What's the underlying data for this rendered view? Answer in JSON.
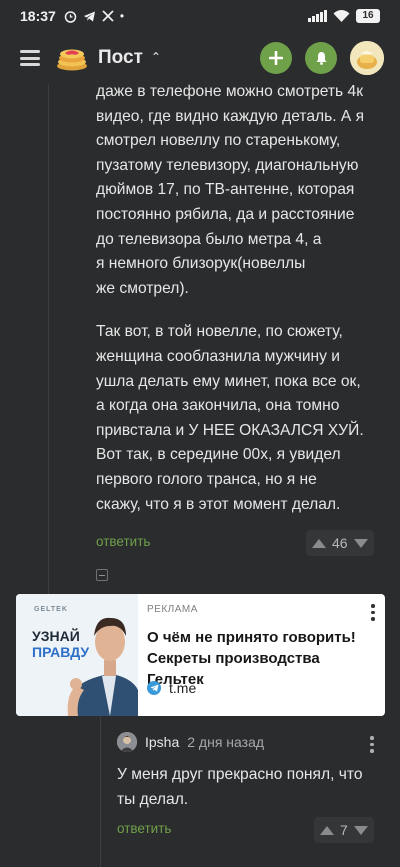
{
  "status_bar": {
    "time": "18:37",
    "battery": "16",
    "icons": [
      "alarm-icon",
      "telegram-icon",
      "x-icon",
      "dots-icon",
      "signal-icon",
      "wifi-icon",
      "battery-icon"
    ]
  },
  "header": {
    "title": "Пост",
    "menu_icon": "hamburger-icon",
    "add_icon": "plus-icon",
    "notify_icon": "bell-icon",
    "accent_color": "#6fa04a"
  },
  "comment": {
    "paragraphs": [
      [
        "даже в телефоне можно смотреть 4к",
        "видео, где видно каждую деталь. А я",
        "смотрел новеллу по старенькому,",
        "пузатому телевизору, диагональную",
        "дюймов 17, по ТВ-антенне, которая",
        "постоянно рябила, да и расстояние",
        "до телевизора было метра 4, а",
        "я немного близорук(новеллы",
        "же смотрел)."
      ],
      [
        "Так вот, в той новелле, по сюжету,",
        "женщина сооблазнила мужчину и",
        "ушла делать ему минет, пока все ок,",
        "а когда она закончила, она томно",
        "привстала и У НЕЕ ОКАЗАЛСЯ ХУЙ.",
        "Вот так, в середине 00х, я увидел",
        "первого голого транса, но я не",
        "скажу, что я в этот момент делал."
      ]
    ],
    "reply_label": "ответить",
    "rating": "46"
  },
  "ad": {
    "label": "РЕКЛАМА",
    "brand": "GELTEK",
    "slogan_line1": "УЗНАЙ",
    "slogan_line2": "ПРАВДУ",
    "title": "О чём не принято говорить! Секреты производства Гельтек",
    "source": "t.me"
  },
  "reply": {
    "author": "Ipsha",
    "date": "2 дня назад",
    "text_lines": [
      "У меня друг прекрасно понял, что",
      "ты делал."
    ],
    "reply_label": "ответить",
    "rating": "7"
  }
}
